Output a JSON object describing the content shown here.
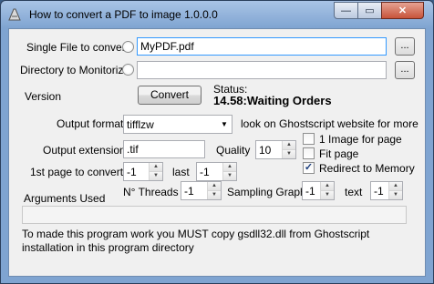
{
  "window": {
    "title": "How to convert a PDF to image 1.0.0.0",
    "controls": {
      "minimize": "—",
      "maximize": "▭",
      "close": "✕"
    }
  },
  "single_file": {
    "label": "Single File to convert",
    "value": "MyPDF.pdf",
    "browse": "..."
  },
  "directory": {
    "label": "Directory to Monitorize",
    "value": "",
    "browse": "..."
  },
  "version": {
    "label": "Version"
  },
  "convert": {
    "label": "Convert"
  },
  "status": {
    "label": "Status:",
    "value": "14.58:Waiting Orders"
  },
  "output_format": {
    "label": "Output format",
    "value": "tifflzw",
    "hint": "look on Ghostscript website for more"
  },
  "output_extension": {
    "label": "Output extension",
    "value": ".tif"
  },
  "quality": {
    "label": "Quality",
    "value": "10"
  },
  "options": {
    "one_image_per_page": {
      "label": "1 Image for page",
      "checked": false
    },
    "fit_page": {
      "label": "Fit page",
      "checked": false
    },
    "redirect_to_memory": {
      "label": "Redirect to Memory",
      "checked": true
    }
  },
  "first_page": {
    "label": "1st page to convert",
    "value": "-1"
  },
  "last_page": {
    "label": "last",
    "value": "-1"
  },
  "arguments": {
    "label": "Arguments Used",
    "value": ""
  },
  "threads": {
    "label": "N° Threads",
    "value": "-1"
  },
  "sampling_graph": {
    "label": "Sampling Graph",
    "value": "-1"
  },
  "text": {
    "label": "text",
    "value": "-1"
  },
  "note": "To made this program work you MUST copy gsdll32.dll from Ghostscript installation in this program directory"
}
